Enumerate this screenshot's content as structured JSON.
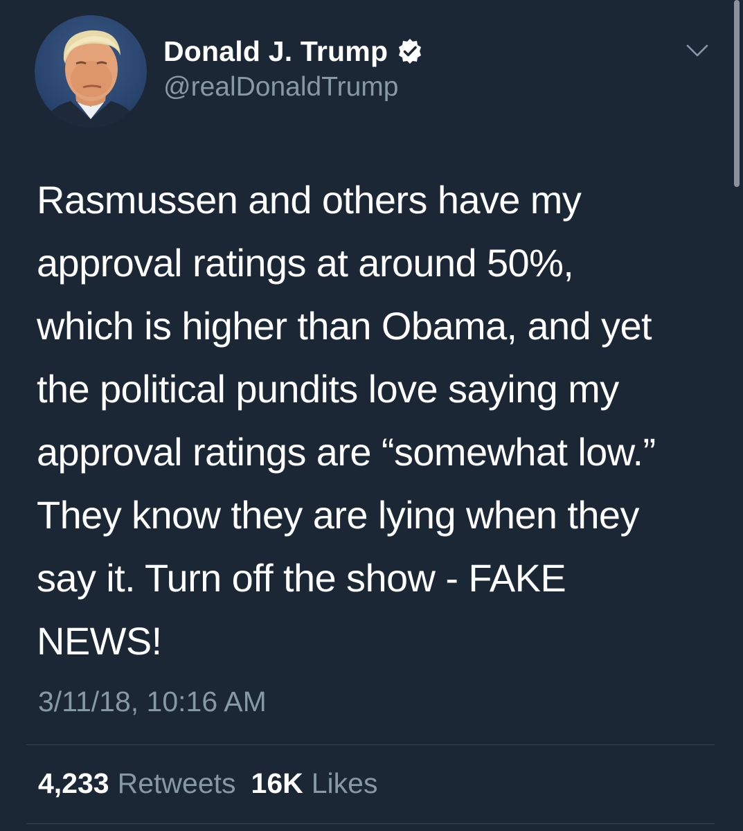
{
  "author": {
    "display_name": "Donald J. Trump",
    "handle": "@realDonaldTrump",
    "verified": true
  },
  "tweet": {
    "text": "Rasmussen and others have my\napproval ratings at around 50%,\nwhich is higher than Obama, and yet\nthe political pundits love saying my\napproval ratings are “somewhat low.”\nThey know they are lying when they\nsay it. Turn off the show - FAKE\nNEWS!",
    "timestamp": "3/11/18, 10:16 AM"
  },
  "stats": {
    "retweets_count": "4,233",
    "retweets_label": "Retweets",
    "likes_count": "16K",
    "likes_label": "Likes"
  },
  "icons": {
    "verified": "verified-badge-icon",
    "menu": "chevron-down-icon"
  },
  "colors": {
    "background": "#1b2735",
    "primary_text": "#ffffff",
    "secondary_text": "#8899a6",
    "divider": "#38444d"
  }
}
